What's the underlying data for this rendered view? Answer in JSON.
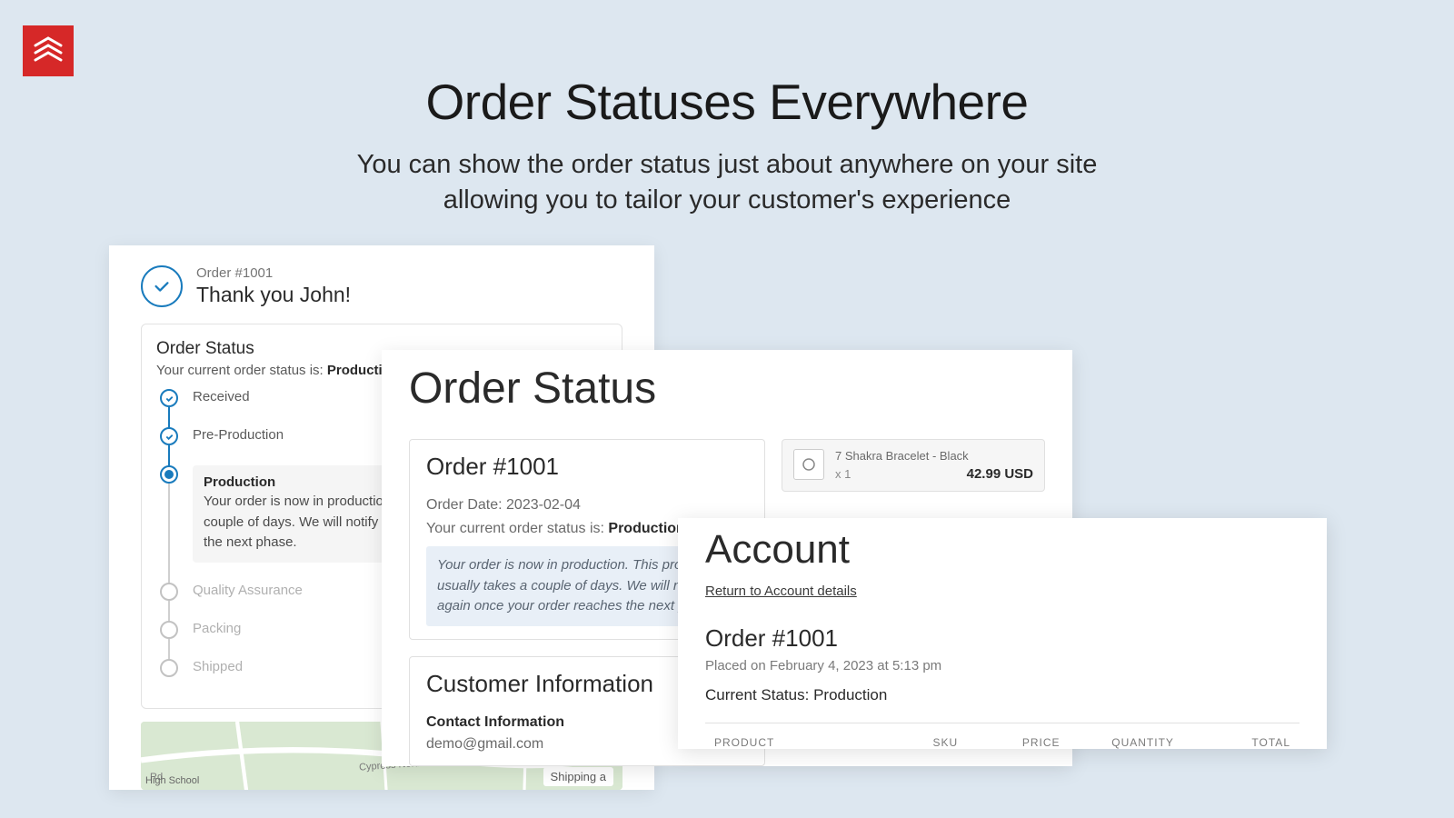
{
  "hero": {
    "title": "Order Statuses Everywhere",
    "subtitle_l1": "You can show the order status just about anywhere on your site",
    "subtitle_l2": "allowing you to tailor your customer's experience"
  },
  "card1": {
    "order_num": "Order #1001",
    "thank_you": "Thank you John!",
    "status_title": "Order Status",
    "status_sub_pre": "Your current order status is: ",
    "status_sub_val": "Production",
    "steps": {
      "received": "Received",
      "preprod": "Pre-Production",
      "prod_title": "Production",
      "prod_desc": "Your order is now in production. This process usually takes a couple of days. We will notify you again once your order reaches the next phase.",
      "qa": "Quality Assurance",
      "packing": "Packing",
      "shipped": "Shipped"
    },
    "map": {
      "shipping_label": "Shipping a",
      "road": "Cypress North Houston Rd",
      "school": "High School",
      "rd": "Rd"
    }
  },
  "card2": {
    "heading": "Order Status",
    "order_heading": "Order #1001",
    "order_date": "Order Date: 2023-02-04",
    "current_pre": "Your current order status is: ",
    "current_val": "Production",
    "note": "Your order is now in production. This process usually takes a couple of days. We will notify you again once your order reaches the next phase.",
    "cust_heading": "Customer Information",
    "contact_label": "Contact Information",
    "email": "demo@gmail.com",
    "product": {
      "name": "7 Shakra Bracelet - Black",
      "qty": "x 1",
      "price": "42.99 USD"
    }
  },
  "card3": {
    "heading": "Account",
    "return_link": "Return to Account details",
    "order_heading": "Order #1001",
    "placed": "Placed on February 4, 2023 at 5:13 pm",
    "current_pre": "Current Status: ",
    "current_val": "Production",
    "th": {
      "product": "PRODUCT",
      "sku": "SKU",
      "price": "PRICE",
      "qty": "QUANTITY",
      "total": "TOTAL"
    }
  }
}
